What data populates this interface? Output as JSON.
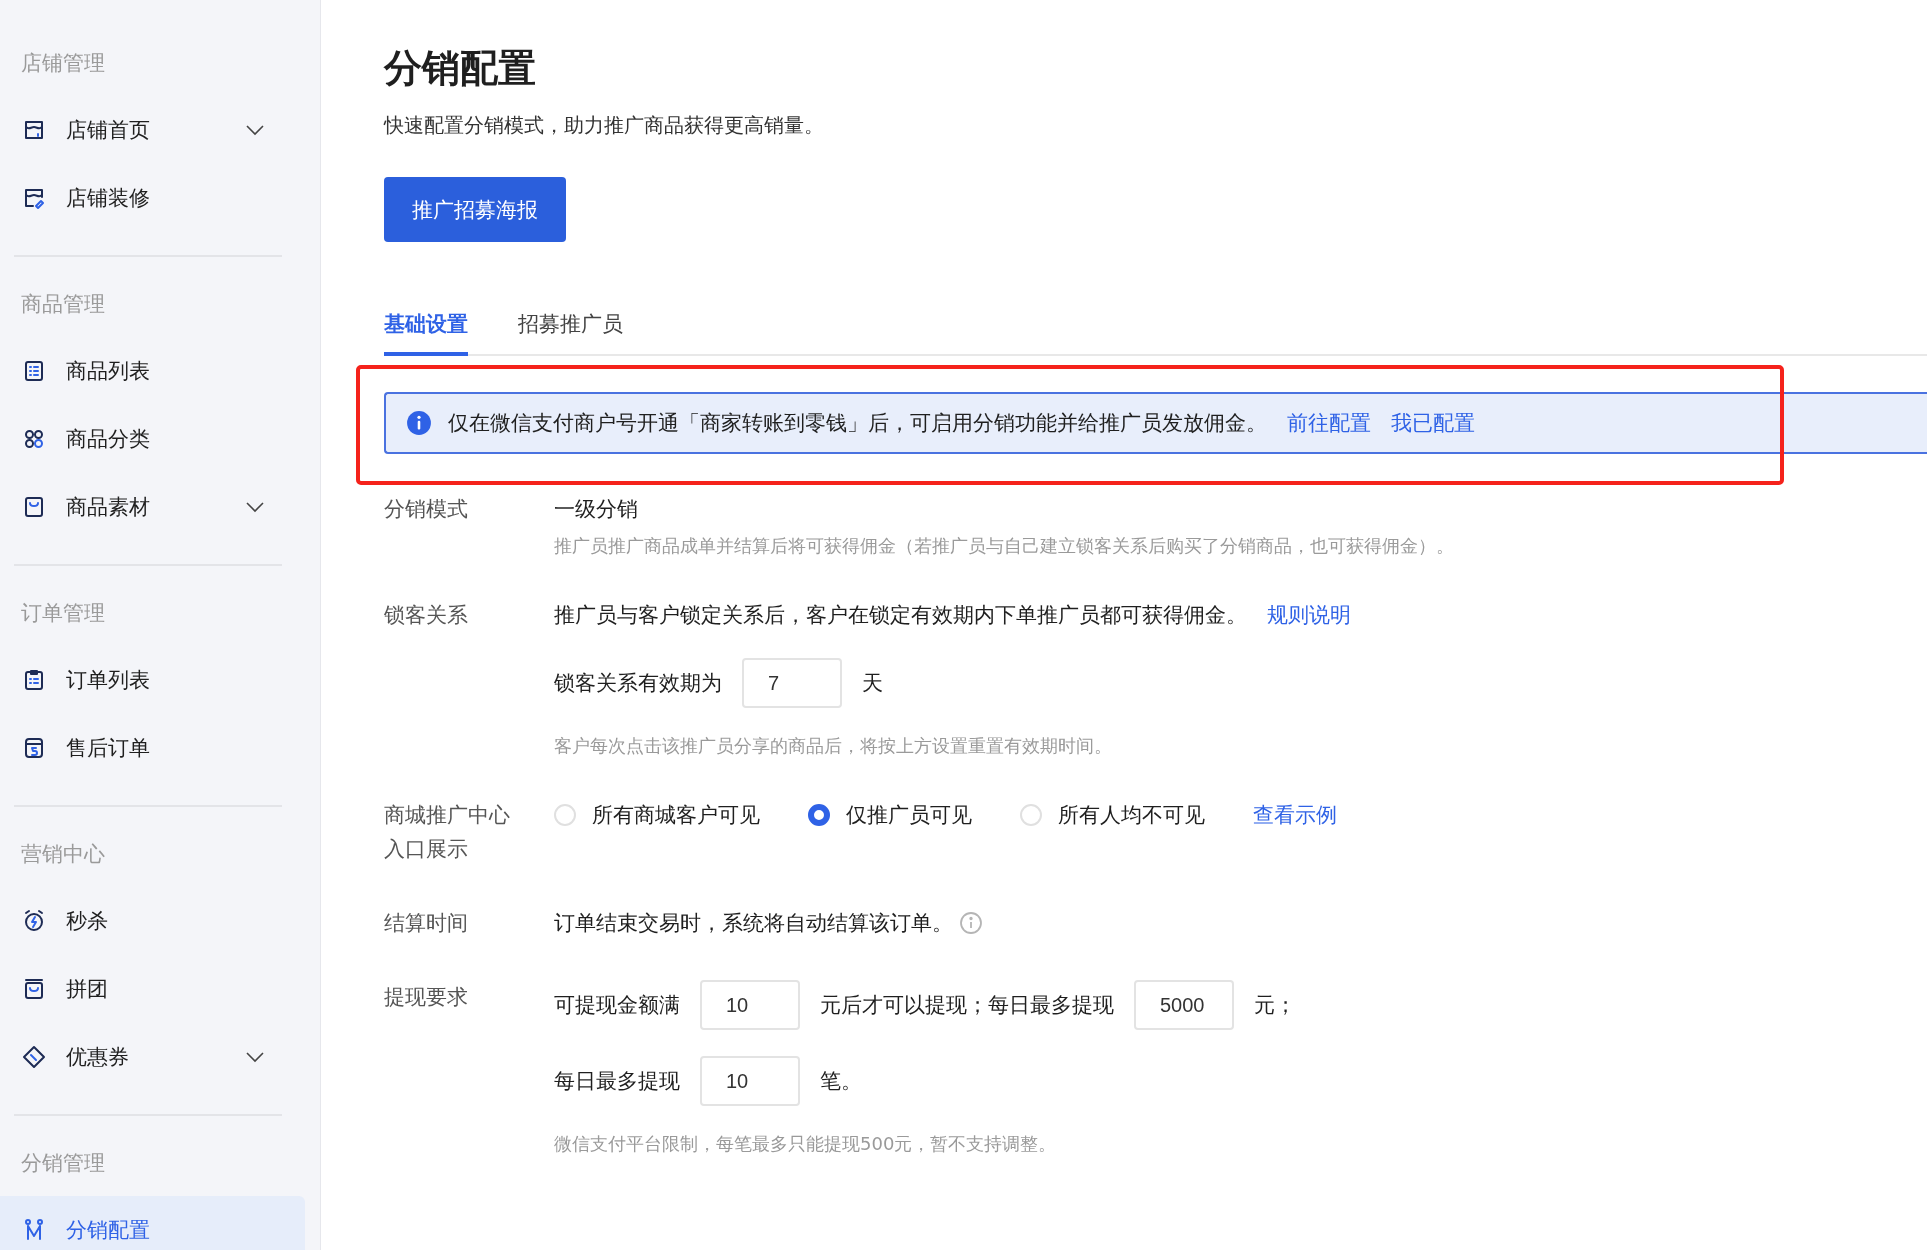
{
  "sidebar": {
    "groups": [
      {
        "title": "店铺管理",
        "items": [
          {
            "label": "店铺首页",
            "has_submenu": true,
            "selected": false
          },
          {
            "label": "店铺装修",
            "has_submenu": false,
            "selected": false
          }
        ]
      },
      {
        "title": "商品管理",
        "items": [
          {
            "label": "商品列表",
            "has_submenu": false,
            "selected": false
          },
          {
            "label": "商品分类",
            "has_submenu": false,
            "selected": false
          },
          {
            "label": "商品素材",
            "has_submenu": true,
            "selected": false
          }
        ]
      },
      {
        "title": "订单管理",
        "items": [
          {
            "label": "订单列表",
            "has_submenu": false,
            "selected": false
          },
          {
            "label": "售后订单",
            "has_submenu": false,
            "selected": false
          }
        ]
      },
      {
        "title": "营销中心",
        "items": [
          {
            "label": "秒杀",
            "has_submenu": false,
            "selected": false
          },
          {
            "label": "拼团",
            "has_submenu": false,
            "selected": false
          },
          {
            "label": "优惠券",
            "has_submenu": true,
            "selected": false
          }
        ]
      },
      {
        "title": "分销管理",
        "items": [
          {
            "label": "分销配置",
            "has_submenu": false,
            "selected": true
          }
        ]
      }
    ]
  },
  "page": {
    "title": "分销配置",
    "subtitle": "快速配置分销模式，助力推广商品获得更高销量。",
    "primary_button": "推广招募海报"
  },
  "tabs": [
    {
      "label": "基础设置",
      "selected": true
    },
    {
      "label": "招募推广员",
      "selected": false
    }
  ],
  "alert": {
    "text": "仅在微信支付商户号开通「商家转账到零钱」后，可启用分销功能并给推广员发放佣金。",
    "links": [
      "前往配置",
      "我已配置"
    ],
    "highlighted": true
  },
  "form": [
    {
      "label": "分销模式",
      "lines": [
        [
          {
            "kind": "text",
            "text": "一级分销"
          }
        ]
      ],
      "hint": "推广员推广商品成单并结算后将可获得佣金（若推广员与自己建立锁客关系后购买了分销商品，也可获得佣金）。"
    },
    {
      "label": "锁客关系",
      "lines": [
        [
          {
            "kind": "text",
            "text": "推广员与客户锁定关系后，客户在锁定有效期内下单推广员都可获得佣金。"
          },
          {
            "kind": "link",
            "text": "规则说明"
          }
        ],
        [
          {
            "kind": "text",
            "text": "锁客关系有效期为"
          },
          {
            "kind": "input",
            "value": "7"
          },
          {
            "kind": "text",
            "text": "天"
          }
        ]
      ],
      "hint": "客户每次点击该推广员分享的商品后，将按上方设置重置有效期时间。"
    },
    {
      "label": "商城推广中心入口展示",
      "lines": [
        [
          {
            "kind": "radio",
            "text": "所有商城客户可见",
            "selected": false
          },
          {
            "kind": "radio",
            "text": "仅推广员可见",
            "selected": true
          },
          {
            "kind": "radio",
            "text": "所有人均不可见",
            "selected": false
          },
          {
            "kind": "link",
            "text": "查看示例"
          }
        ]
      ]
    },
    {
      "label": "结算时间",
      "lines": [
        [
          {
            "kind": "text",
            "text": "订单结束交易时，系统将自动结算该订单。"
          },
          {
            "kind": "info"
          }
        ]
      ]
    },
    {
      "label": "提现要求",
      "lines": [
        [
          {
            "kind": "text",
            "text": "可提现金额满"
          },
          {
            "kind": "input",
            "value": "10"
          },
          {
            "kind": "text",
            "text": "元后才可以提现；每日最多提现"
          },
          {
            "kind": "input",
            "value": "5000"
          },
          {
            "kind": "text",
            "text": "元；"
          }
        ],
        [
          {
            "kind": "text",
            "text": "每日最多提现"
          },
          {
            "kind": "input",
            "value": "10"
          },
          {
            "kind": "text",
            "text": "笔。"
          }
        ]
      ],
      "hint": "微信支付平台限制，每笔最多只能提现500元，暂不支持调整。"
    }
  ]
}
